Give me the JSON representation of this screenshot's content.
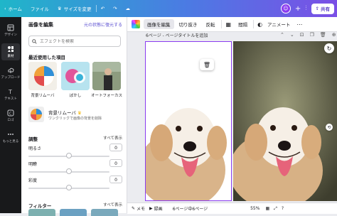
{
  "topbar": {
    "home": "ホーム",
    "file": "ファイル",
    "resize": "サイズを変更",
    "share": "共有",
    "colors": {
      "start": "#1fb6c9",
      "end": "#7b4fe6"
    }
  },
  "rail": [
    {
      "label": "デザイン",
      "icon": "layout-icon"
    },
    {
      "label": "素材",
      "icon": "elements-icon"
    },
    {
      "label": "アップロード",
      "icon": "upload-icon"
    },
    {
      "label": "テキスト",
      "icon": "text-icon"
    },
    {
      "label": "ロゴ",
      "icon": "brand-icon"
    },
    {
      "label": "もっと見る",
      "icon": "more-icon"
    }
  ],
  "panel": {
    "title": "画像を編集",
    "reset": "元の状態に復元する",
    "search_placeholder": "エフェクトを検索",
    "recent_title": "最近使用した項目",
    "recent": [
      {
        "label": "背景リムーバ"
      },
      {
        "label": "ぼかし"
      },
      {
        "label": "オートフォーカス"
      }
    ],
    "feature_title": "背景リムーバ",
    "feature_desc": "ワンクリックで画像の背景を削除",
    "adjust_title": "調整",
    "see_all": "すべて表示",
    "sliders": [
      {
        "label": "明るさ",
        "value": "0",
        "level": 0.5
      },
      {
        "label": "明瞭",
        "value": "0",
        "level": 0.5
      },
      {
        "label": "彩度",
        "value": "0",
        "level": 0.5
      }
    ],
    "filter_title": "フィルター",
    "filter_all": "すべて表示"
  },
  "toolbar": {
    "edit_image": "画像を編集",
    "crop": "切り抜き",
    "flip": "反転",
    "spacing": "間隔",
    "animate": "アニメート"
  },
  "canvas": {
    "page_title": "6ページ - ページタイトルを追加"
  },
  "bottombar": {
    "notes": "メモ",
    "record": "録画",
    "pages": "6ページ中6ページ",
    "zoom": "55%"
  }
}
